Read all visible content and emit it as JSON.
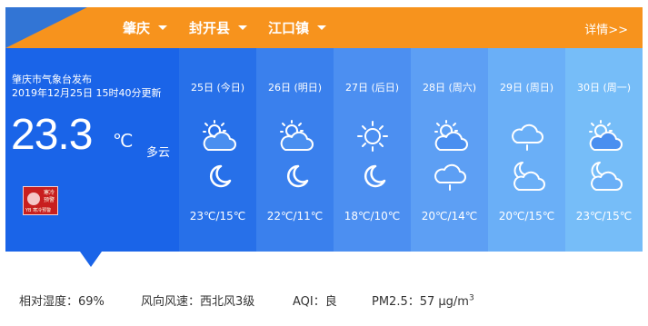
{
  "location": {
    "city": "肇庆",
    "county": "封开县",
    "town": "江口镇",
    "details_link": "详情>>"
  },
  "current": {
    "publisher": "肇庆市气象台发布",
    "updated": "2019年12月25日 15时40分更新",
    "temperature": "23.3",
    "unit": "℃",
    "condition": "多云",
    "warning_icon": "cold-warning-icon",
    "warning_text": [
      "寒冷",
      "预警",
      "YB 寒冷预警"
    ]
  },
  "forecast": [
    {
      "date": "25日 (今日)",
      "day_icon": "partly-cloudy-day-icon",
      "night_icon": "clear-night-icon",
      "range": "23℃/15℃",
      "bg": "#2770e9"
    },
    {
      "date": "26日 (明日)",
      "day_icon": "partly-cloudy-day-icon",
      "night_icon": "clear-night-icon",
      "range": "22℃/11℃",
      "bg": "#3a80ed"
    },
    {
      "date": "27日 (后日)",
      "day_icon": "sunny-icon",
      "night_icon": "clear-night-icon",
      "range": "18℃/10℃",
      "bg": "#4c8ff1"
    },
    {
      "date": "28日 (周六)",
      "day_icon": "partly-cloudy-day-icon",
      "night_icon": "cloudy-rain-icon",
      "range": "20℃/14℃",
      "bg": "#5d9ff4"
    },
    {
      "date": "29日 (周日)",
      "day_icon": "cloudy-rain-icon",
      "night_icon": "partly-cloudy-night-icon",
      "range": "20℃/15℃",
      "bg": "#6aaff7"
    },
    {
      "date": "30日 (周一)",
      "day_icon": "partly-cloudy-day-icon",
      "night_icon": "partly-cloudy-night-icon",
      "range": "23℃/15℃",
      "bg": "#76bdf8"
    }
  ],
  "stats": {
    "humidity": "相对湿度：69%",
    "wind": "风向风速：西北风3级",
    "aqi": "AQI：良",
    "pm25_prefix": "PM2.5：57 μg/m",
    "pm25_sup": "3"
  },
  "colors": {
    "header_orange": "#f7931d",
    "current_blue": "#1a64e8"
  }
}
